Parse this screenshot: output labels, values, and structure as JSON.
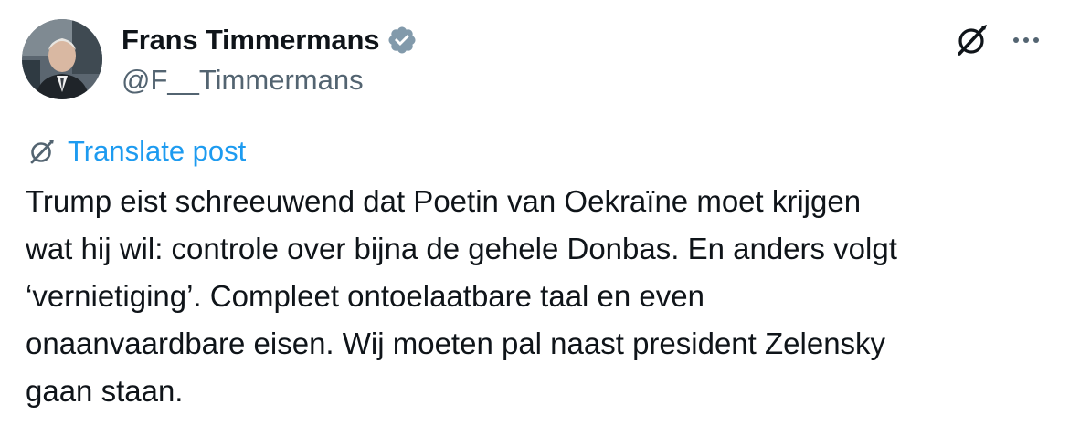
{
  "author": {
    "display_name": "Frans Timmermans",
    "handle": "@F__Timmermans",
    "verified": true,
    "verified_color": "#829aab"
  },
  "icons": {
    "verified": "verified-badge-icon",
    "grok": "grok-icon",
    "more": "more-options-icon",
    "translate": "translate-icon"
  },
  "translate": {
    "label": "Translate post",
    "color": "#1d9bf0"
  },
  "post": {
    "text": "Trump eist schreeuwend dat Poetin van Oekraïne moet krijgen\nwat hij wil: controle over bijna de gehele Donbas. En anders volgt\n‘vernietiging’. Compleet ontoelaatbare taal en even\nonaanvaardbare eisen. Wij moeten pal naast president Zelensky\ngaan staan."
  }
}
